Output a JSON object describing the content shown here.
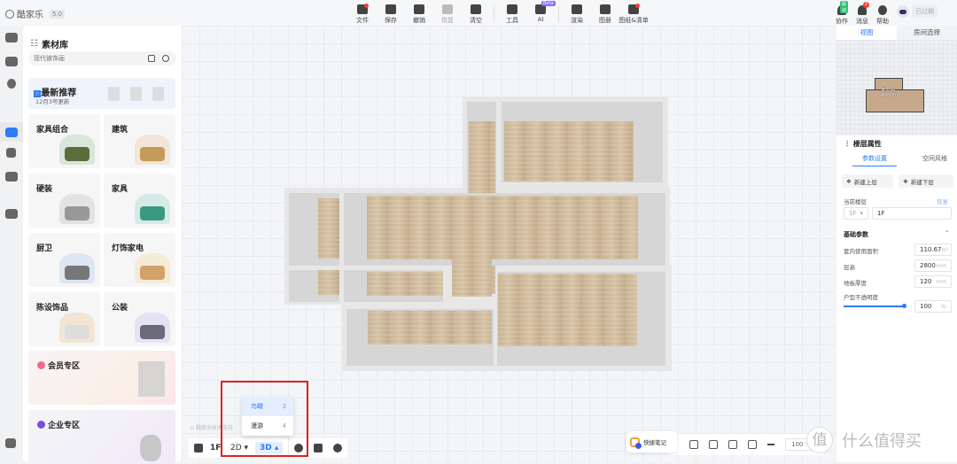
{
  "app": {
    "name": "酷家乐",
    "version": "5.0"
  },
  "toolbar": {
    "items": [
      {
        "label": "文件",
        "dot": true
      },
      {
        "label": "保存"
      },
      {
        "label": "撤销"
      },
      {
        "label": "恢复",
        "disabled": true
      },
      {
        "label": "清空"
      },
      {
        "label": "工具"
      },
      {
        "label": "AI",
        "badge": "Beta"
      },
      {
        "label": "渲染"
      },
      {
        "label": "图册"
      },
      {
        "label": "图纸&清单",
        "dot": true
      }
    ]
  },
  "topright": {
    "collab": "协作",
    "collab_badge": "联动",
    "messages": "消息",
    "messages_count": "2",
    "help": "帮助",
    "expired": "已过期"
  },
  "library": {
    "title": "素材库",
    "search_placeholder": "现代被饰画",
    "recommend": {
      "title": "最新推荐",
      "subtitle": "12月3号更新"
    },
    "cards": [
      {
        "label": "家具组合"
      },
      {
        "label": "建筑"
      },
      {
        "label": "硬装"
      },
      {
        "label": "家具"
      },
      {
        "label": "厨卫"
      },
      {
        "label": "灯饰家电"
      },
      {
        "label": "陈设饰品"
      },
      {
        "label": "公装"
      }
    ],
    "zones": [
      {
        "label": "会员专区"
      },
      {
        "label": "企业专区"
      }
    ]
  },
  "sidebar_icons": [
    "building-icon",
    "floor-icon",
    "lamp-icon",
    "sofa-icon",
    "user-icon",
    "cabinet-icon",
    "puzzle-icon"
  ],
  "view": {
    "floor": "1F",
    "mode2d": "2D",
    "mode3d": "3D",
    "watermark": "酷家乐技术支持",
    "dropdown": [
      {
        "label": "鸟瞰",
        "shortcut": "3",
        "selected": true
      },
      {
        "label": "漫游",
        "shortcut": "4"
      }
    ]
  },
  "bottombar": {
    "quicknote": "快捷笔记",
    "zoom": "100",
    "zoom_unit": "%"
  },
  "right": {
    "tabs": [
      "视图",
      "房间选择"
    ],
    "minimap_label": "未命名",
    "minimap_area": "42.78m²",
    "floorprops": "楼层属性",
    "subtabs": [
      "参数设置",
      "空间风格"
    ],
    "new_up": "新建上层",
    "new_down": "新建下层",
    "current_floor_label": "当前楼层",
    "restore": "恢复",
    "current_floor_select": "1F",
    "current_floor_value": "1F",
    "basic": "基础参数",
    "params": [
      {
        "label": "套内使用面积",
        "value": "110.67",
        "unit": "m²"
      },
      {
        "label": "层高",
        "value": "2800",
        "unit": "mm"
      },
      {
        "label": "地板厚度",
        "value": "120",
        "unit": "mm"
      }
    ],
    "opacity_label": "户型不透明度",
    "opacity_value": "100",
    "opacity_unit": "%",
    "opacity_fraction": 1.0
  },
  "watermark_site": {
    "glyph": "值",
    "text": "什么值得买"
  }
}
